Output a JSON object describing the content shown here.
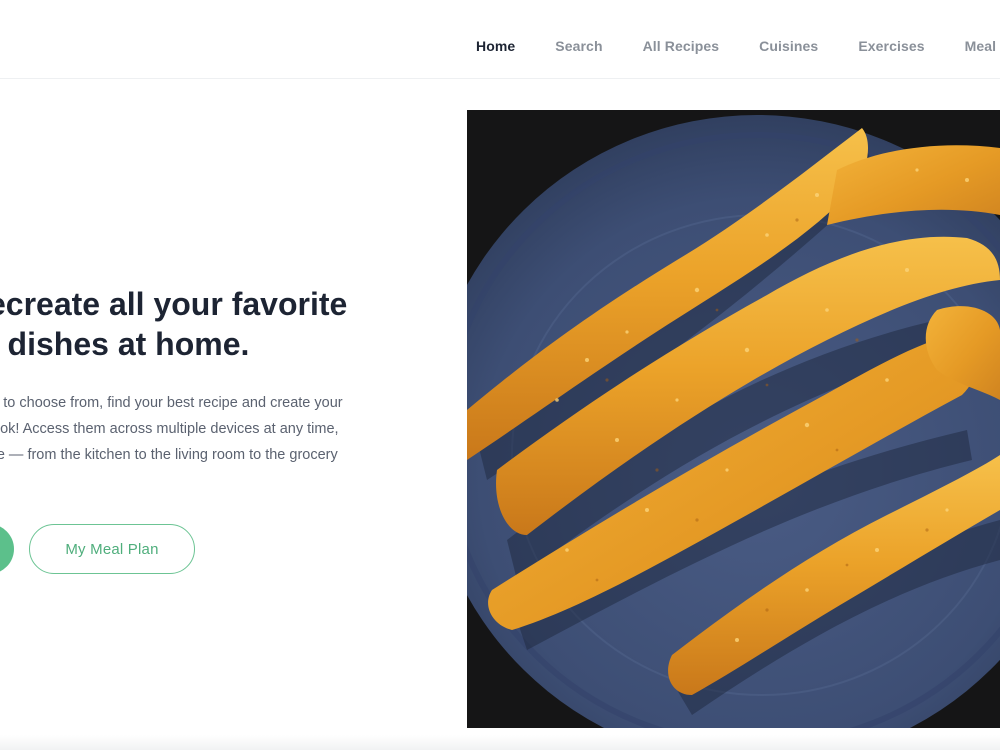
{
  "nav": {
    "items": [
      {
        "label": "Home",
        "active": true
      },
      {
        "label": "Search",
        "active": false
      },
      {
        "label": "All Recipes",
        "active": false
      },
      {
        "label": "Cuisines",
        "active": false
      },
      {
        "label": "Exercises",
        "active": false
      },
      {
        "label": "Meal Pla",
        "active": false
      }
    ]
  },
  "hero": {
    "title_lines": [
      "ecreate all your favorite",
      "t dishes at home."
    ],
    "description_lines": [
      "s to choose from, find your best recipe and create your",
      "ook! Access them across multiple devices at any time,",
      "re — from the kitchen to the living room to the grocery"
    ],
    "primary_button_label": "",
    "secondary_button_label": "My Meal Plan"
  },
  "image": {
    "subject": "fried-food-strips-on-blue-plate"
  },
  "colors": {
    "accent_green": "#5cc08b",
    "heading": "#1d2433",
    "nav_muted": "#8a9099",
    "body_text": "#5b6270",
    "plate_blue": "#3f5177"
  }
}
